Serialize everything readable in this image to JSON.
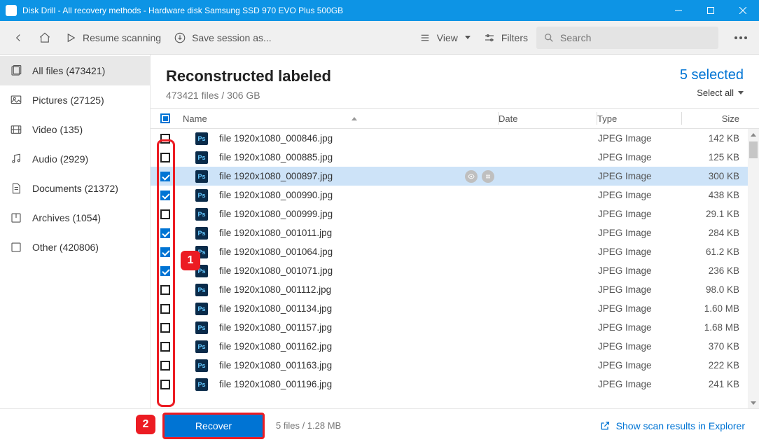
{
  "window": {
    "title": "Disk Drill - All recovery methods - Hardware disk Samsung SSD 970 EVO Plus 500GB"
  },
  "toolbar": {
    "resume_label": "Resume scanning",
    "save_session_label": "Save session as...",
    "view_label": "View",
    "filters_label": "Filters",
    "search_placeholder": "Search"
  },
  "sidebar": {
    "items": [
      {
        "label": "All files (473421)",
        "selected": true
      },
      {
        "label": "Pictures (27125)",
        "selected": false
      },
      {
        "label": "Video (135)",
        "selected": false
      },
      {
        "label": "Audio (2929)",
        "selected": false
      },
      {
        "label": "Documents (21372)",
        "selected": false
      },
      {
        "label": "Archives (1054)",
        "selected": false
      },
      {
        "label": "Other (420806)",
        "selected": false
      }
    ]
  },
  "content": {
    "title": "Reconstructed labeled",
    "summary": "473421 files / 306 GB",
    "selected_text": "5 selected",
    "select_all_label": "Select all",
    "columns": {
      "name": "Name",
      "date": "Date",
      "type": "Type",
      "size": "Size"
    },
    "rows": [
      {
        "name": "file 1920x1080_000846.jpg",
        "type": "JPEG Image",
        "size": "142 KB",
        "checked": false,
        "highlighted": false
      },
      {
        "name": "file 1920x1080_000885.jpg",
        "type": "JPEG Image",
        "size": "125 KB",
        "checked": false,
        "highlighted": false
      },
      {
        "name": "file 1920x1080_000897.jpg",
        "type": "JPEG Image",
        "size": "300 KB",
        "checked": true,
        "highlighted": true
      },
      {
        "name": "file 1920x1080_000990.jpg",
        "type": "JPEG Image",
        "size": "438 KB",
        "checked": true,
        "highlighted": false
      },
      {
        "name": "file 1920x1080_000999.jpg",
        "type": "JPEG Image",
        "size": "29.1 KB",
        "checked": false,
        "highlighted": false
      },
      {
        "name": "file 1920x1080_001011.jpg",
        "type": "JPEG Image",
        "size": "284 KB",
        "checked": true,
        "highlighted": false
      },
      {
        "name": "file 1920x1080_001064.jpg",
        "type": "JPEG Image",
        "size": "61.2 KB",
        "checked": true,
        "highlighted": false
      },
      {
        "name": "file 1920x1080_001071.jpg",
        "type": "JPEG Image",
        "size": "236 KB",
        "checked": true,
        "highlighted": false
      },
      {
        "name": "file 1920x1080_001112.jpg",
        "type": "JPEG Image",
        "size": "98.0 KB",
        "checked": false,
        "highlighted": false
      },
      {
        "name": "file 1920x1080_001134.jpg",
        "type": "JPEG Image",
        "size": "1.60 MB",
        "checked": false,
        "highlighted": false
      },
      {
        "name": "file 1920x1080_001157.jpg",
        "type": "JPEG Image",
        "size": "1.68 MB",
        "checked": false,
        "highlighted": false
      },
      {
        "name": "file 1920x1080_001162.jpg",
        "type": "JPEG Image",
        "size": "370 KB",
        "checked": false,
        "highlighted": false
      },
      {
        "name": "file 1920x1080_001163.jpg",
        "type": "JPEG Image",
        "size": "222 KB",
        "checked": false,
        "highlighted": false
      },
      {
        "name": "file 1920x1080_001196.jpg",
        "type": "JPEG Image",
        "size": "241 KB",
        "checked": false,
        "highlighted": false
      }
    ]
  },
  "footer": {
    "recover_label": "Recover",
    "summary": "5 files / 1.28 MB",
    "explorer_link": "Show scan results in Explorer"
  },
  "annotations": {
    "one": "1",
    "two": "2"
  }
}
